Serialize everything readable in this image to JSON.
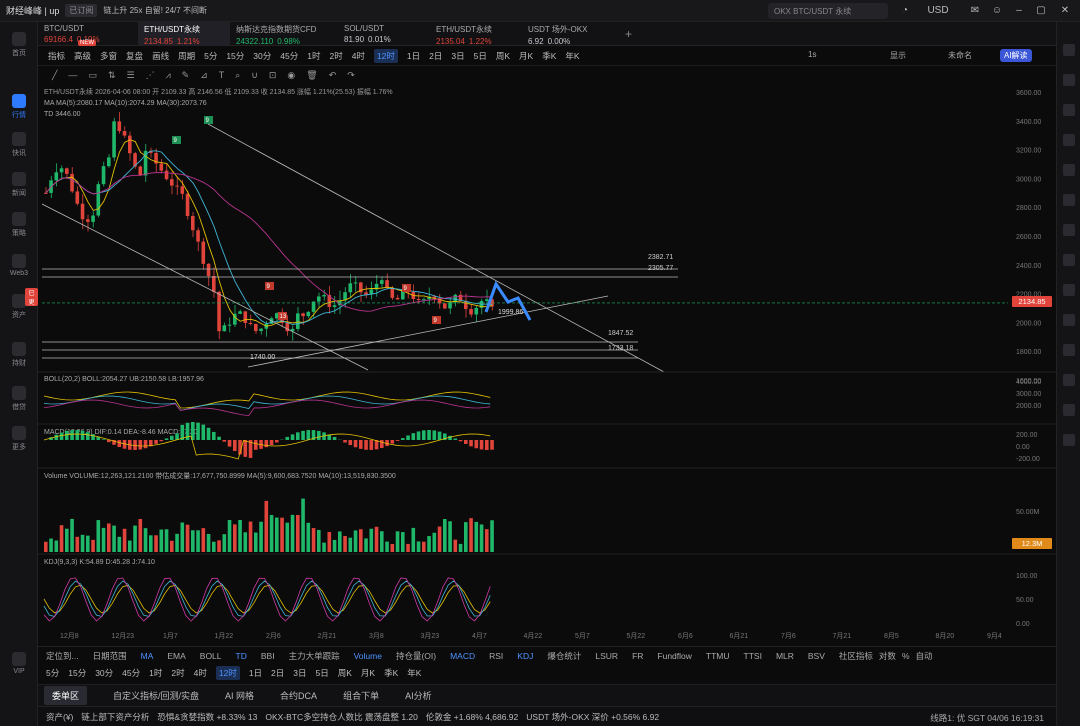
{
  "topbar": {
    "brand": "财经峰峰 | up",
    "tag": "已订阅",
    "news": "链上升 25x 自留! 24/7 不间断",
    "search_placeholder": "OKX BTC/USDT 永续",
    "currency": "USD"
  },
  "sidebar": [
    {
      "label": "首页",
      "icon": "home-icon"
    },
    {
      "label": "行情",
      "icon": "chart-icon",
      "active": true
    },
    {
      "label": "快讯",
      "icon": "flash-icon"
    },
    {
      "label": "新闻",
      "icon": "news-icon"
    },
    {
      "label": "策略",
      "icon": "strategy-icon"
    },
    {
      "label": "Web3",
      "icon": "web3-icon"
    },
    {
      "label": "资产",
      "icon": "wallet-icon",
      "badge": "已更"
    },
    {
      "label": "持财",
      "icon": "finance-icon"
    },
    {
      "label": "借贷",
      "icon": "loan-icon"
    },
    {
      "label": "更多",
      "icon": "more-icon"
    },
    {
      "label": "VIP",
      "icon": "vip-icon"
    }
  ],
  "tabs": [
    {
      "name": "BTC/USDT",
      "price": "69166.4",
      "change": "0.19%",
      "dir": "red",
      "badge": "NEW"
    },
    {
      "name": "ETH/USDT永续",
      "price": "2134.85",
      "change": "1.21%",
      "dir": "red",
      "sel": true
    },
    {
      "name": "纳斯达克指数期货CFD",
      "price": "24322.110",
      "change": "0.98%",
      "dir": "green"
    },
    {
      "name": "SOL/USDT",
      "price": "81.90",
      "change": "0.01%",
      "dir": "white"
    },
    {
      "name": "ETH/USDT永续",
      "price": "2135.04",
      "change": "1.22%",
      "dir": "red"
    },
    {
      "name": "USDT 场外-OKX",
      "price": "6.92",
      "change": "0.00%",
      "dir": "white"
    }
  ],
  "toolbar": {
    "items": [
      "指标",
      "高级",
      "多窗",
      "复盘",
      "画线",
      "周期",
      "5分",
      "15分",
      "30分",
      "45分",
      "1时",
      "2时",
      "4时",
      "12时",
      "1日",
      "2日",
      "3日",
      "5日",
      "周K",
      "月K",
      "季K",
      "年K"
    ],
    "active": "12时",
    "right": [
      "1s",
      "显示",
      "未命名"
    ],
    "ai": "AI解读"
  },
  "chart": {
    "symbol": "ETH/USDT永续",
    "ohlc": "2026-04-06 08:00  开 2109.33  高 2146.56  低 2109.33  收 2134.85  涨幅 1.21%(25.53)  振幅 1.76%",
    "ma": "MA(5):2080.17  MA(10):2074.29  MA(30):2073.76",
    "td": "TD",
    "td_val": "3446.00",
    "price_axis": [
      "3600.00",
      "3400.00",
      "3200.00",
      "3000.00",
      "2800.00",
      "2600.00",
      "2400.00",
      "2200.00",
      "2000.00",
      "1800.00",
      "1600.00"
    ],
    "last_price": "2134.85",
    "levels": [
      {
        "v": "2382.71"
      },
      {
        "v": "2305.77"
      },
      {
        "v": "1999.86"
      },
      {
        "v": "1847.52"
      },
      {
        "v": "1733.18"
      },
      {
        "v": "1740.00"
      }
    ],
    "xaxis": [
      "12月8",
      "12月23",
      "1月7",
      "1月22",
      "2月6",
      "2月21",
      "3月8",
      "3月23",
      "4月7",
      "4月22",
      "5月7",
      "5月22",
      "6月6",
      "6月21",
      "7月6",
      "7月21",
      "8月5",
      "8月20",
      "9月4"
    ],
    "boll": "BOLL(20,2)  BOLL:2054.27  UB:2150.58  LB:1957.96",
    "boll_axis": [
      "4000.00",
      "3000.00",
      "2000.00"
    ],
    "macd": "MACD(12,26,9)  DIF:0.14  DEA:-8.46  MACD:17.20",
    "macd_axis": [
      "200.00",
      "0.00",
      "-200.00"
    ],
    "vol": "Volume  VOLUME:12,263,121.2100  带估成交量:17,677,750.8999  MA(5):9,600,683.7520  MA(10):13,519,830.3500",
    "vol_axis": [
      "50.00M"
    ],
    "vol_tag": "12.3M",
    "kdj": "KDJ(9,3,3)  K:54.89  D:45.28  J:74.10",
    "kdj_axis": [
      "100.00",
      "50.00",
      "0.00"
    ]
  },
  "bottom_tools": {
    "left": [
      "定位到...",
      "日期范围"
    ],
    "items": [
      "MA",
      "EMA",
      "BOLL",
      "TD",
      "BBI",
      "主力大单跟踪",
      "Volume",
      "持仓量(OI)",
      "MACD",
      "RSI",
      "KDJ",
      "爆仓统计",
      "LSUR",
      "FR",
      "Fundflow",
      "TTMU",
      "TTSI",
      "MLR",
      "BSV"
    ],
    "right": [
      "社区指标",
      "对数",
      "%",
      "自动"
    ]
  },
  "periods": [
    "5分",
    "15分",
    "30分",
    "45分",
    "1时",
    "2时",
    "4时",
    "12时",
    "1日",
    "2日",
    "3日",
    "5日",
    "周K",
    "月K",
    "季K",
    "年K"
  ],
  "period_active": "12时",
  "bottom_tabs": [
    "委单区",
    "自定义指标/回测/实盘",
    "AI 网格",
    "合约DCA",
    "组合下单",
    "AI分析"
  ],
  "status": {
    "items": [
      "资产(¥)",
      "链上部下资产分析",
      "恐惧&贪婪指数 +8.33% 13",
      "OKX-BTC多空持仓人数比 震荡盘整 1.20",
      "伦敦金 +1.68% 4,686.92",
      "USDT 场外-OKX 深价 +0.56% 6.92"
    ],
    "right": "线路1: 优  SGT 04/06 16:19:31"
  },
  "colors": {
    "up": "#1fb86a",
    "down": "#e0443a",
    "accent": "#2f7bff"
  }
}
